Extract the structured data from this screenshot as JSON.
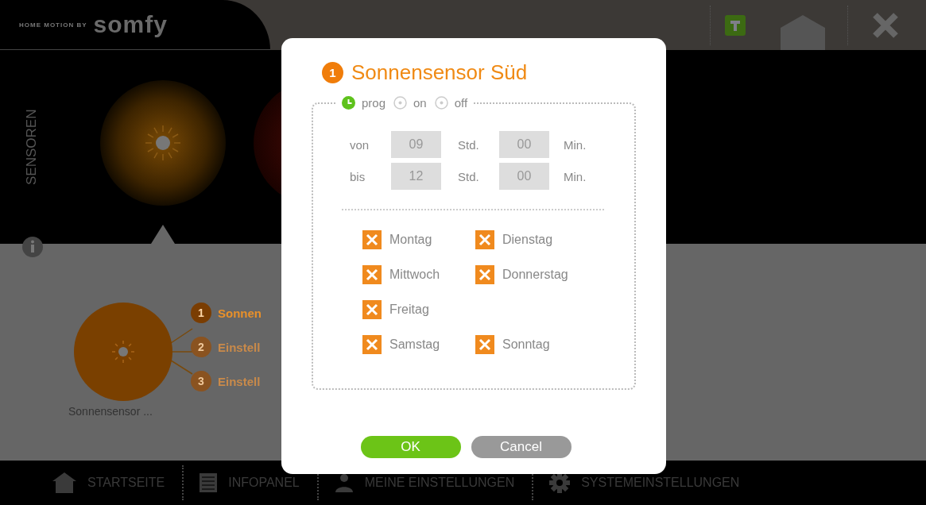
{
  "header": {
    "tagline": "HOME MOTION BY",
    "brand": "somfy"
  },
  "sensors_panel": {
    "title": "SENSOREN"
  },
  "sensor": {
    "name": "Sonnensensor ...",
    "steps": [
      {
        "number": "1",
        "label": "Sonnen",
        "selected": true
      },
      {
        "number": "2",
        "label": "Einstell",
        "selected": false
      },
      {
        "number": "3",
        "label": "Einstell",
        "selected": false
      }
    ]
  },
  "nav": [
    {
      "kind": "home",
      "label": "STARTSEITE"
    },
    {
      "kind": "info",
      "label": "INFOPANEL"
    },
    {
      "kind": "user",
      "label": "MEINE EINSTELLUNGEN"
    },
    {
      "kind": "system",
      "label": "SYSTEMEINSTELLUNGEN"
    }
  ],
  "dialog": {
    "badge": "1",
    "title": "Sonnensensor Süd",
    "modes": [
      {
        "label": "prog",
        "selected": true
      },
      {
        "label": "on",
        "selected": false
      },
      {
        "label": "off",
        "selected": false
      }
    ],
    "times": [
      {
        "label": "von",
        "hours": "09",
        "hours_unit": "Std.",
        "minutes": "00",
        "minutes_unit": "Min."
      },
      {
        "label": "bis",
        "hours": "12",
        "hours_unit": "Std.",
        "minutes": "00",
        "minutes_unit": "Min."
      }
    ],
    "day_rows": [
      [
        {
          "label": "Montag",
          "checked": true
        },
        {
          "label": "Dienstag",
          "checked": true
        }
      ],
      [
        {
          "label": "Mittwoch",
          "checked": true
        },
        {
          "label": "Donnerstag",
          "checked": true
        }
      ],
      [
        {
          "label": "Freitag",
          "checked": true
        }
      ],
      [
        {
          "label": "Samstag",
          "checked": true
        },
        {
          "label": "Sonntag",
          "checked": true
        }
      ]
    ],
    "buttons": [
      {
        "kind": "primary",
        "label": "OK"
      },
      {
        "kind": "secondary",
        "label": "Cancel"
      }
    ]
  }
}
